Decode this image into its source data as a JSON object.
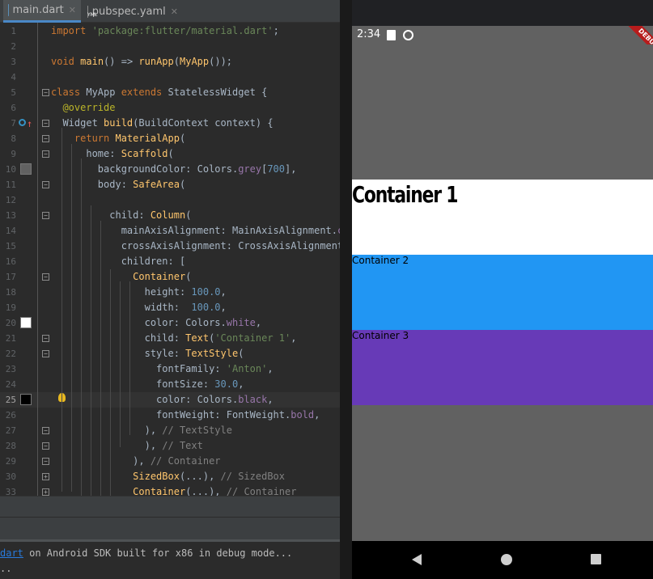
{
  "tabs": [
    {
      "label": "main.dart",
      "icon": "dart-file-icon",
      "active": true
    },
    {
      "label": "pubspec.yaml",
      "icon": "yaml-file-icon",
      "active": false
    }
  ],
  "editor": {
    "current_line": 25,
    "lines": [
      {
        "n": "1",
        "html": "<span class=\"kw\">import</span> <span class=\"str\">'package:flutter/material.dart'</span>;"
      },
      {
        "n": "2",
        "html": ""
      },
      {
        "n": "3",
        "html": "<span class=\"kw\">void</span> <span class=\"fn\">main</span>() => <span class=\"fn\">runApp</span>(<span class=\"cls\">MyApp</span>());"
      },
      {
        "n": "4",
        "html": ""
      },
      {
        "n": "5",
        "html": "<span class=\"kw\">class</span> MyApp <span class=\"kw\">extends</span> StatelessWidget {"
      },
      {
        "n": "6",
        "html": "  <span class=\"ann\">@override</span>"
      },
      {
        "n": "7",
        "html": "  Widget <span class=\"fn\">build</span>(BuildContext context) {"
      },
      {
        "n": "8",
        "html": "    <span class=\"kw\">return</span> <span class=\"cls\">MaterialApp</span>("
      },
      {
        "n": "9",
        "html": "      home: <span class=\"cls\">Scaffold</span>("
      },
      {
        "n": "10",
        "html": "        backgroundColor: Colors.<span class=\"prop\">grey</span>[<span class=\"num\">700</span>],"
      },
      {
        "n": "11",
        "html": "        body: <span class=\"cls\">SafeArea</span>("
      },
      {
        "n": "12",
        "html": ""
      },
      {
        "n": "13",
        "html": "          child: <span class=\"cls\">Column</span>("
      },
      {
        "n": "14",
        "html": "            mainAxisAlignment: MainAxisAlignment.<span class=\"prop\">center</span>,"
      },
      {
        "n": "15",
        "html": "            crossAxisAlignment: CrossAxisAlignment.<span class=\"prop\">stretch</span>,"
      },
      {
        "n": "16",
        "html": "            children: <Widget>["
      },
      {
        "n": "17",
        "html": "              <span class=\"cls\">Container</span>("
      },
      {
        "n": "18",
        "html": "                height: <span class=\"num\">100.0</span>,"
      },
      {
        "n": "19",
        "html": "                width:  <span class=\"num\">100.0</span>,"
      },
      {
        "n": "20",
        "html": "                color: Colors.<span class=\"prop\">white</span>,"
      },
      {
        "n": "21",
        "html": "                child: <span class=\"cls\">Text</span>(<span class=\"str\">'Container 1'</span>,"
      },
      {
        "n": "22",
        "html": "                style: <span class=\"cls\">TextStyle</span>("
      },
      {
        "n": "23",
        "html": "                  fontFamily: <span class=\"str\">'Anton'</span>,"
      },
      {
        "n": "24",
        "html": "                  fontSize: <span class=\"num\">30.0</span>,"
      },
      {
        "n": "25",
        "html": "                  color: Colors.<span class=\"prop\">black</span>,"
      },
      {
        "n": "26",
        "html": "                  fontWeight: FontWeight.<span class=\"prop\">bold</span>,"
      },
      {
        "n": "27",
        "html": "                ), <span class=\"cm\">// TextStyle</span>"
      },
      {
        "n": "28",
        "html": "                ), <span class=\"cm\">// Text</span>"
      },
      {
        "n": "29",
        "html": "              ), <span class=\"cm\">// Container</span>"
      },
      {
        "n": "30",
        "html": "              <span class=\"cls\">SizedBox</span>(...), <span class=\"cm\">// SizedBox</span>"
      },
      {
        "n": "33",
        "html": "              <span class=\"cls\">Container</span>(...), <span class=\"cm\">// Container</span>"
      }
    ]
  },
  "console": {
    "link_text": "dart",
    "message": " on Android SDK built for x86 in debug mode...",
    "line2": ".."
  },
  "device": {
    "status_time": "2:34",
    "debug_banner": "DEBUG",
    "app_background": "#616161",
    "containers": [
      {
        "label": "Container 1",
        "color": "#ffffff"
      },
      {
        "label": "Container 2",
        "color": "#2196f3"
      },
      {
        "label": "Container 3",
        "color": "#673ab7"
      }
    ],
    "nav": [
      "back",
      "home",
      "recents"
    ]
  }
}
